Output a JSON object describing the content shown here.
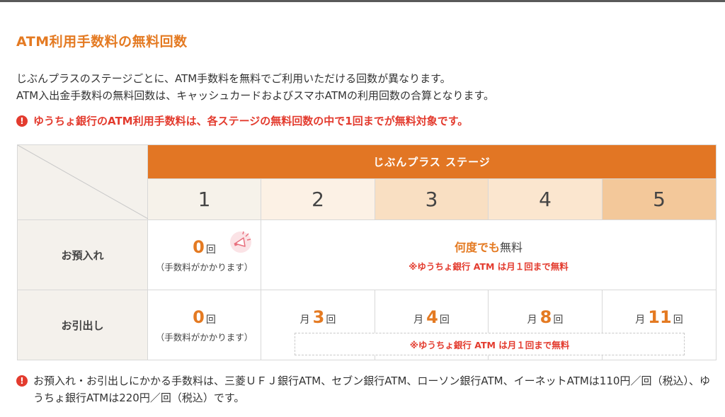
{
  "title": "ATM利用手数料の無料回数",
  "desc_line1": "じぶんプラスのステージごとに、ATM手数料を無料でご利用いただける回数が異なります。",
  "desc_line2": "ATM入出金手数料の無料回数は、キャッシュカードおよびスマホATMの利用回数の合算となります。",
  "warning": "ゆうちょ銀行のATM利用手数料は、各ステージの無料回数の中で1回までが無料対象です。",
  "alert_mark": "!",
  "table": {
    "stage_header": "じぶんプラス ステージ",
    "stages": [
      "1",
      "2",
      "3",
      "4",
      "5"
    ],
    "deposit": {
      "label": "お預入れ",
      "stage1_count": "0",
      "stage1_unit": "回",
      "stage1_note": "（手数料がかかります）",
      "other_emph": "何度でも",
      "other_text": "無料",
      "other_note": "※ゆうちょ銀行 ATM は月１回まで無料"
    },
    "withdraw": {
      "label": "お引出し",
      "stage1_count": "0",
      "stage1_unit": "回",
      "stage1_note": "（手数料がかかります）",
      "month_label": "月",
      "unit": "回",
      "counts": [
        "3",
        "4",
        "8",
        "11"
      ],
      "note": "※ゆうちょ銀行 ATM は月１回まで無料"
    }
  },
  "footer_note": "お預入れ・お引出しにかかる手数料は、三菱ＵＦＪ銀行ATM、セブン銀行ATM、ローソン銀行ATM、イーネットATMは110円／回（税込）、ゆうちょ銀行ATMは220円／回（税込）です。",
  "colors": {
    "accent": "#e47a22",
    "header_orange": "#e27624",
    "warning_red": "#e33b2e"
  },
  "icons": [
    "alert-icon",
    "megaphone-icon"
  ]
}
